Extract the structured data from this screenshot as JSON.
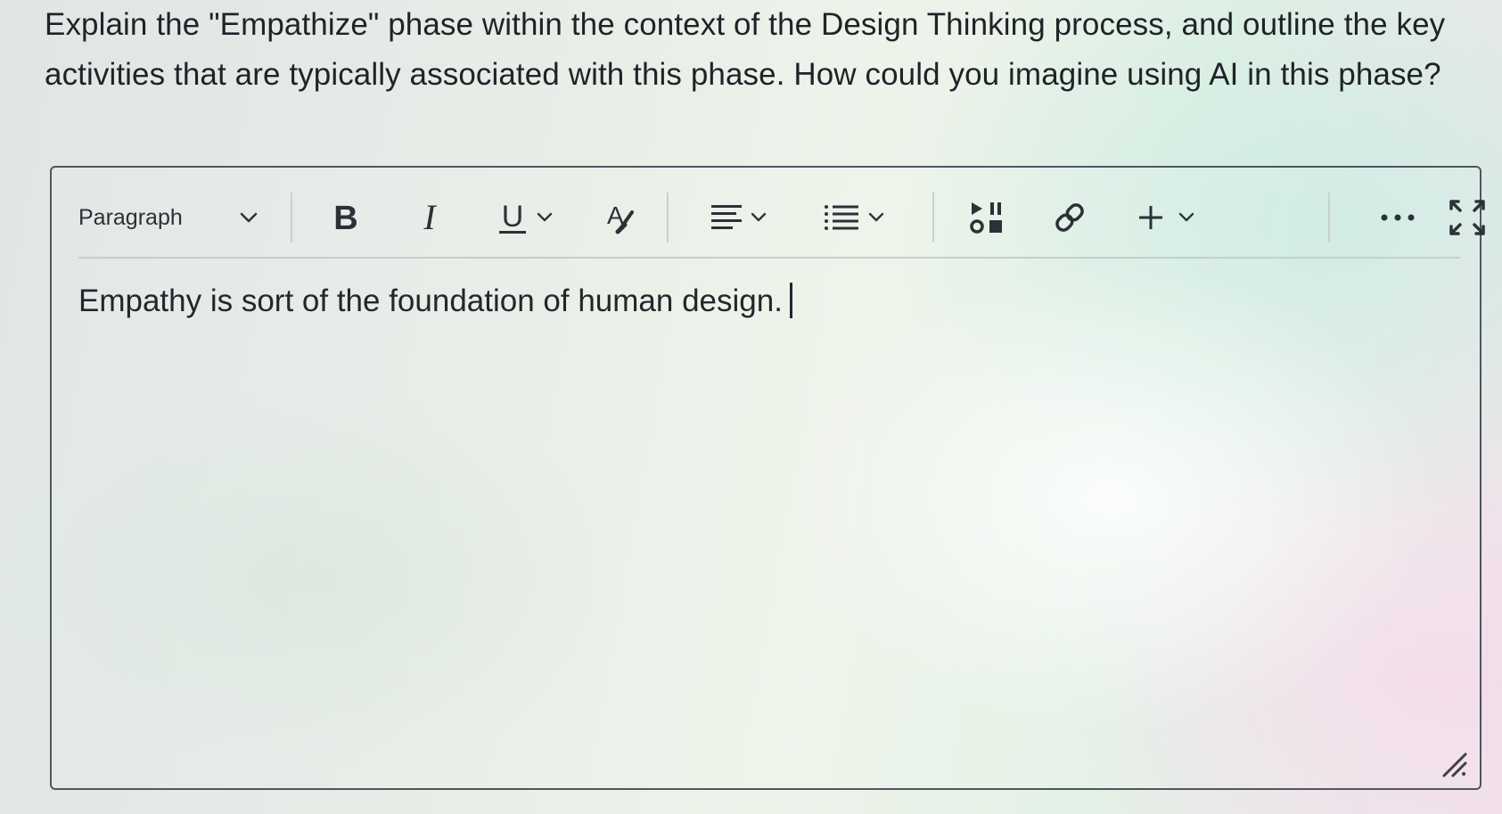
{
  "question": {
    "text": "Explain the \"Empathize\" phase within the context of the Design Thinking process, and outline the key activities that are typically associated with this phase. How could you imagine using AI in this phase?"
  },
  "toolbar": {
    "block_format_value": "Paragraph",
    "icons": {
      "bold": "bold-icon",
      "italic": "italic-icon",
      "underline": "underline-icon",
      "format": "text-format-icon",
      "align": "align-icon",
      "list": "list-icon",
      "media": "media-icon",
      "link": "link-icon",
      "insert": "plus-icon",
      "more": "more-icon",
      "fullscreen": "fullscreen-icon"
    }
  },
  "editor": {
    "content": "Empathy is sort of the foundation of human design."
  },
  "colors": {
    "text": "#1f2329",
    "border": "#4f5661",
    "icon": "#30353b"
  }
}
